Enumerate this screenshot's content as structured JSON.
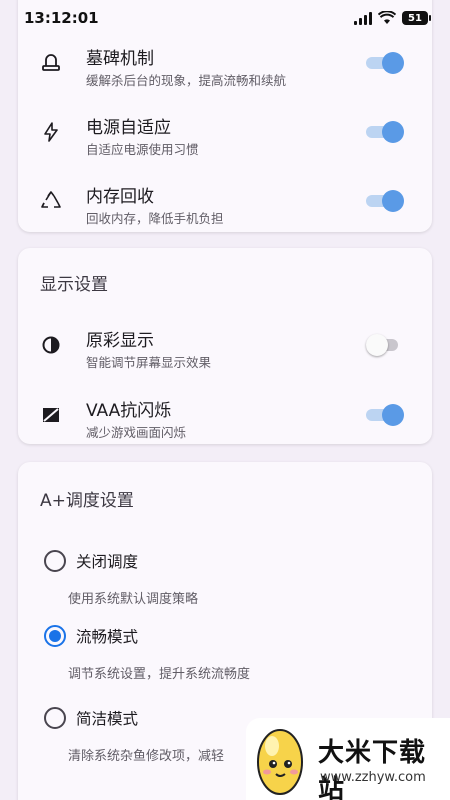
{
  "status_bar": {
    "time": "13:12:01",
    "battery": "51"
  },
  "performance_card": {
    "items": [
      {
        "icon": "tombstone-icon",
        "title": "墓碑机制",
        "subtitle": "缓解杀后台的现象，提高流畅和续航",
        "enabled": true
      },
      {
        "icon": "lightning-icon",
        "title": "电源自适应",
        "subtitle": "自适应电源使用习惯",
        "enabled": true
      },
      {
        "icon": "recycle-icon",
        "title": "内存回收",
        "subtitle": "回收内存，降低手机负担",
        "enabled": true
      }
    ]
  },
  "display_card": {
    "title": "显示设置",
    "items": [
      {
        "icon": "contrast-icon",
        "title": "原彩显示",
        "subtitle": "智能调节屏幕显示效果",
        "enabled": false
      },
      {
        "icon": "flicker-icon",
        "title": "VAA抗闪烁",
        "subtitle": "减少游戏画面闪烁",
        "enabled": true
      }
    ]
  },
  "scheduling_card": {
    "title": "A+调度设置",
    "options": [
      {
        "label": "关闭调度",
        "description": "使用系统默认调度策略",
        "selected": false
      },
      {
        "label": "流畅模式",
        "description": "调节系统设置，提升系统流畅度",
        "selected": true
      },
      {
        "label": "简洁模式",
        "description": "清除系统杂鱼修改项，减轻",
        "selected": false
      }
    ]
  },
  "watermark": {
    "brand": "大米下载站",
    "url": "www.zzhyw.com"
  },
  "colors": {
    "accent": "#1a73e8",
    "toggle_on": "#5a9ae6",
    "background": "#f3eef7"
  }
}
